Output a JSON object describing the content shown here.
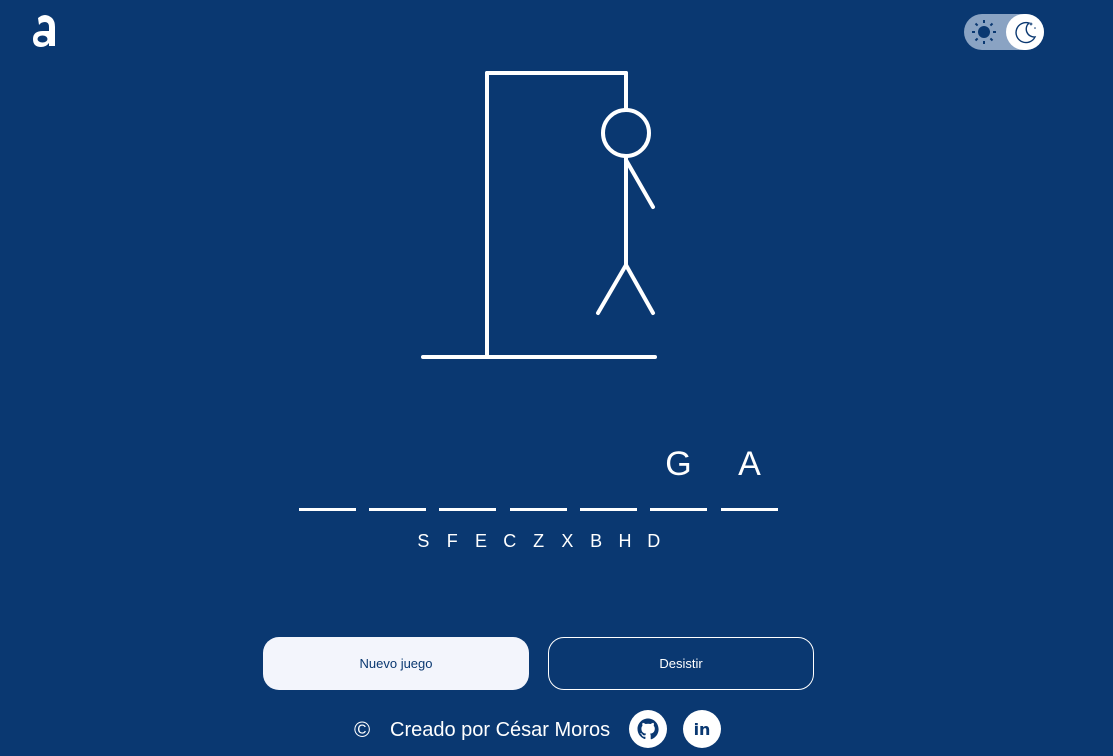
{
  "app": {
    "logo_icon": "alura-a-logo-icon",
    "accent_color": "#0a3871",
    "text_color": "#ffffff"
  },
  "theme_toggle": {
    "light_icon": "sun-icon",
    "dark_icon": "moon-icon",
    "selected": "dark"
  },
  "game": {
    "hangman_parts_shown": [
      "gallows",
      "head",
      "body",
      "right-arm",
      "left-leg",
      "right-leg"
    ],
    "word_slots": [
      "",
      "",
      "",
      "",
      "",
      "G",
      "A"
    ],
    "wrong_letters": [
      "S",
      "F",
      "E",
      "C",
      "Z",
      "X",
      "B",
      "H",
      "D"
    ]
  },
  "buttons": {
    "new_game": "Nuevo juego",
    "give_up": "Desistir"
  },
  "footer": {
    "copyright_symbol": "©",
    "credit": "Creado por César Moros",
    "github_icon": "github-icon",
    "linkedin_icon": "linkedin-icon",
    "linkedin_label": "in"
  }
}
